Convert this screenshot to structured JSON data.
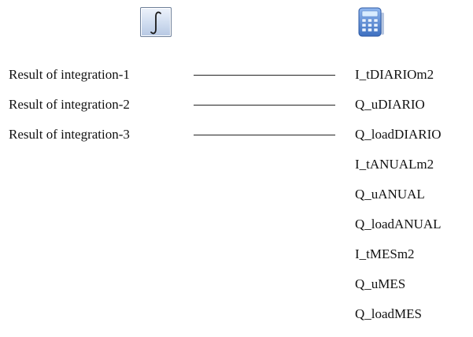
{
  "blocks": {
    "integrator": {
      "icon": "integral-icon",
      "symbol": "∫"
    },
    "calculator": {
      "icon": "calculator-icon"
    }
  },
  "inputs": [
    {
      "label": "Result of integration-1",
      "connected_to": "I_tDIARIOm2"
    },
    {
      "label": "Result of integration-2",
      "connected_to": "Q_uDIARIO"
    },
    {
      "label": "Result of integration-3",
      "connected_to": "Q_loadDIARIO"
    }
  ],
  "outputs": [
    "I_tDIARIOm2",
    "Q_uDIARIO",
    "Q_loadDIARIO",
    "I_tANUALm2",
    "Q_uANUAL",
    "Q_loadANUAL",
    "I_tMESm2",
    "Q_uMES",
    "Q_loadMES"
  ],
  "colors": {
    "wire": "#222222",
    "text": "#111111",
    "integrator_fill": "#cfdcef",
    "calculator_body": "#4a7fd0"
  }
}
